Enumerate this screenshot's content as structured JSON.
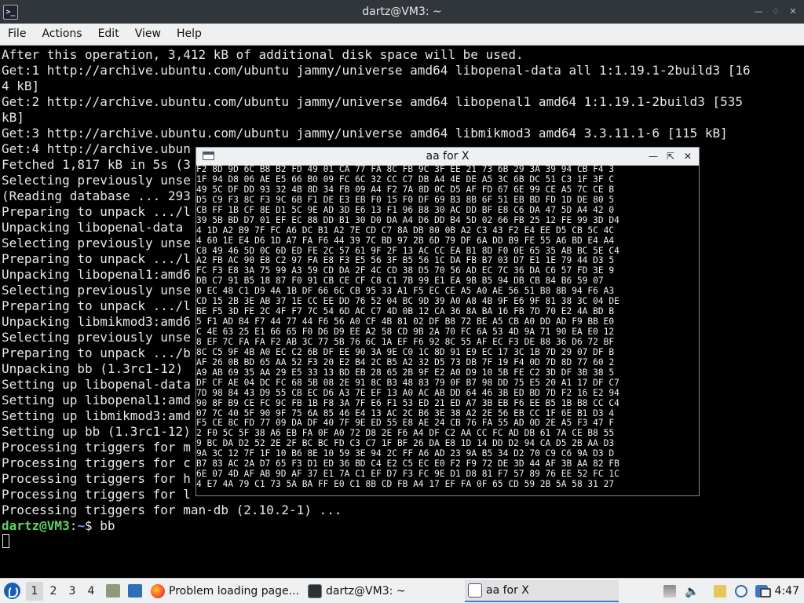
{
  "window": {
    "title": "dartz@VM3: ~",
    "menu": [
      "File",
      "Actions",
      "Edit",
      "View",
      "Help"
    ]
  },
  "terminal": {
    "lines": [
      "After this operation, 3,412 kB of additional disk space will be used.",
      "Get:1 http://archive.ubuntu.com/ubuntu jammy/universe amd64 libopenal-data all 1:1.19.1-2build3 [16",
      "4 kB]",
      "Get:2 http://archive.ubuntu.com/ubuntu jammy/universe amd64 libopenal1 amd64 1:1.19.1-2build3 [535",
      "kB]",
      "Get:3 http://archive.ubuntu.com/ubuntu jammy/universe amd64 libmikmod3 amd64 3.3.11.1-6 [115 kB]",
      "Get:4 http://archive.ubun",
      "Fetched 1,817 kB in 5s (3",
      "Selecting previously unse",
      "(Reading database ... 293",
      "Preparing to unpack .../l",
      "Unpacking libopenal-data",
      "Selecting previously unse",
      "Preparing to unpack .../l",
      "Unpacking libopenal1:amd6",
      "Selecting previously unse",
      "Preparing to unpack .../l",
      "Unpacking libmikmod3:amd6",
      "Selecting previously unse",
      "Preparing to unpack .../b",
      "Unpacking bb (1.3rc1-12)",
      "Setting up libopenal-data",
      "Setting up libopenal1:amd",
      "Setting up libmikmod3:amd",
      "Setting up bb (1.3rc1-12)",
      "Processing triggers for m",
      "Processing triggers for c",
      "Processing triggers for h",
      "Processing triggers for l",
      "Processing triggers for man-db (2.10.2-1) ..."
    ],
    "prompt": {
      "user_host": "dartz@VM3",
      "separator": ":",
      "path": "~",
      "symbol": "$ ",
      "command": "bb"
    }
  },
  "aa_window": {
    "title": "aa for X",
    "hex_lines": [
      "F2 8D 9D 6C B8 B2 FD 49 01 CA 77 FA 8C FB 9C 3F EE 21 73 6B 29 3A 39 94 CB F4 3",
      "1F 94 D8 06 AE E5 66 B0 09 FC 6C 32 CC C7 DB A4 4E DE A5 3C 6B DC 51 C3 1F 3F C",
      "49 5C DF DD 93 32 4B 8D 34 FB 09 A4 F2 7A 8D 0C D5 AF FD 67 6E 99 CE A5 7C CE B",
      "D5 C9 F3 8C F3 9C 6B F1 DE E3 EB F0 15 F0 DF 69 B3 8B 6F 51 EB BD FD 1D DE 80 5",
      "CB FF 1B CF 8E D1 5C 9E AD 3D E6 13 F1 96 B8 30 AC DD BF E8 C6 DA 47 5D A4 42 0",
      "39 5B BD D7 01 EF EC 88 DD B1 30 D0 DA A4 D6 DD B4 5D 02 66 FB 25 12 FE 99 3D D4",
      "4 1D A2 B9 7F FC A6 DC B1 A2 7E CD C7 8A DB 80 0B A2 C3 43 F2 E4 EE D5 CB 5C 4C",
      "4 60 1E E4 D6 1D A7 FA F6 44 39 7C BD 97 2B 6D 79 DF 6A DD B9 FE 55 A6 BD E4 A4",
      "C8 49 46 5D 0C 6D ED FE 2C 57 61 9F 2F 13 AC CC EA B1 8D F0 0E 65 35 AB BC 5E C4",
      "A2 FB AC 90 E8 C2 97 FA E8 F3 E5 56 3F B5 56 1C DA FB B7 03 D7 E1 1E 79 44 D3 5",
      "FC F3 E8 3A 75 99 A3 59 CD DA 2F 4C CD 38 D5 70 56 AD EC 7C 36 DA C6 57 FD 3E 9",
      "DB C7 91 B5 18 87 F0 91 CB CE CF C8 C1 7B 99 E1 EA 9B B5 94 DB CB 84 B6 59 07",
      "0 EC 48 C1 D9 4A 1B DF 66 6C CB 95 33 A1 F5 EC CE A5 A0 AE 56 51 B8 8B 94 F6 A3",
      "CD 15 2B 3E AB 37 1E CC EE DD 76 52 04 BC 9D 39 A0 A8 4B 9F E6 9F 81 38 3C 04 DE",
      "BE F5 3D FE 2C 4F F7 7C 54 6D AC C7 4D 0B 12 CA 36 8A BA 16 FB 7D 70 E2 4A BD B",
      "5 F1 AD B4 F7 44 77 44 F6 56 A0 CF 4B 81 02 DF B8 72 BE A5 CB A0 DD AD F9 BB E0",
      "C 4E 63 25 E1 66 65 F0 D6 D9 EE A2 58 CD 9B 2A 70 FC 6A 53 4D 9A 71 90 EA E0 12",
      "8 EF 7C FA FA F2 AB 3C 77 5B 76 6C 1A EF F6 92 8C 55 AF EC F3 DE 88 36 D6 72 BF",
      "8C C5 9F 4B A0 EC C2 6B DF EE 90 3A 9E C0 1C 8D 91 E9 EC 17 3C 1B 7D 29 07 DF B",
      "AF 26 0B BD 65 AA 52 F3 20 E2 B4 2C B5 A2 32 D5 73 DB 7F 19 F4 0D 7D 8D 77 60 2",
      "A9 AB 69 35 AA 29 E5 33 13 BD EB 28 65 2B 9F E2 A0 D9 10 5B FE C2 3D DF 3B 38 5",
      "DF CF AE 04 DC FC 68 5B 08 2E 91 8C B3 48 83 79 0F B7 98 DD 75 E5 20 A1 17 DF C7",
      "7D 98 84 43 D9 55 CB EC D6 A3 7E EF 13 A0 AC AB DD 64 46 3B ED BD 7D F2 16 E2 94",
      "90 8F B9 CE FC 9C FB 1B F8 3A 7F E6 F1 53 ED 21 ED A7 3B EB F6 EE B5 1B B8 CC C4",
      "07 7C 40 5F 90 9F 75 6A 85 46 E4 13 AC 2C B6 3E 38 A2 2E 56 EB CC 1F 6E B1 D3 4",
      "F5 CE 8C FD 77 09 DA DF 40 7F 9E ED 55 E8 AE 24 CB 76 FA 55 AD 0D 2E A5 F3 47 F",
      "2 F0 5C 5F 38 A6 EB FA 0F A0 72 D8 2E F6 A4 DF C2 AA CC FC AD DB 61 7A CE B8 55",
      "9 BC DA D2 52 2E 2F BC BC FD C3 C7 1F BF 26 DA E8 1D 14 DD D2 94 CA D5 2B AA D3",
      "9A 3C 12 7F 1F 10 B6 8E 10 59 3E 94 2C FF A6 AD 23 9A B5 34 D2 70 C9 C6 9A D3 D",
      "B7 83 AC 2A D7 65 F3 D1 ED 36 BD C4 E2 C5 EC E0 F2 F9 72 DE 3D 44 AF 3B AA 82 FB",
      "6E 07 4D AF AB 9D AF 37 E1 7A C1 EF D7 F3 FC 9E D1 D8 81 F7 57 89 76 EE 52 FC 1C",
      "4 E7 4A 79 C1 73 5A BA FF E0 C1 8B CD FB A4 17 EF FA 0F 65 CD 59 2B 5A 58 31 27"
    ]
  },
  "taskbar": {
    "workspaces": [
      "1",
      "2",
      "3",
      "4"
    ],
    "tasks": [
      {
        "label": "Problem loading page..."
      },
      {
        "label": "dartz@VM3: ~"
      },
      {
        "label": "aa for X"
      }
    ],
    "clock": "4:47"
  }
}
